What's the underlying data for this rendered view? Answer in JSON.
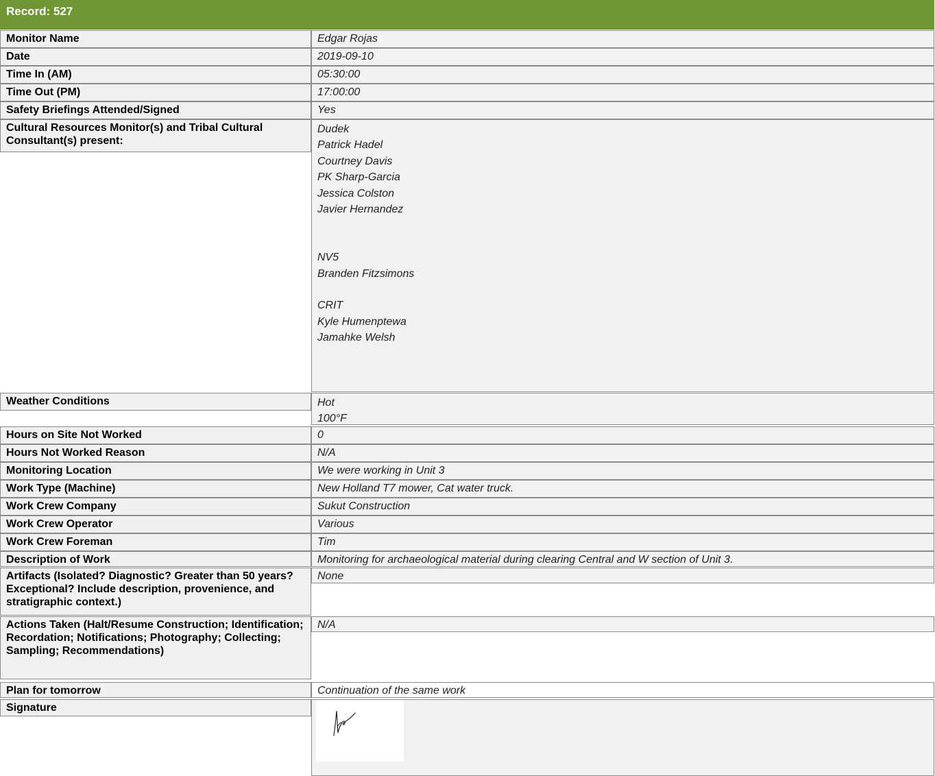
{
  "record": {
    "title": "Record: 527"
  },
  "rows": {
    "monitor_name": {
      "label": "Monitor Name",
      "value": "Edgar Rojas"
    },
    "date": {
      "label": "Date",
      "value": "2019-09-10"
    },
    "time_in": {
      "label": "Time In (AM)",
      "value": "05:30:00"
    },
    "time_out": {
      "label": "Time Out (PM)",
      "value": "17:00:00"
    },
    "safety": {
      "label": "Safety Briefings Attended/Signed",
      "value": "Yes"
    },
    "cultural": {
      "label": "Cultural Resources Monitor(s) and Tribal Cultural Consultant(s) present:",
      "lines": [
        "Dudek",
        "Patrick Hadel",
        "Courtney Davis",
        "PK Sharp-Garcia",
        "Jessica Colston",
        "Javier Hernandez",
        "",
        "",
        "NV5",
        "Branden Fitzsimons",
        "",
        "CRIT",
        "Kyle Humenptewa",
        "Jamahke Welsh"
      ]
    },
    "weather": {
      "label": "Weather Conditions",
      "lines": [
        "Hot",
        "100°F"
      ]
    },
    "hours_not_worked": {
      "label": "Hours on Site Not Worked",
      "value": "0"
    },
    "hours_reason": {
      "label": "Hours Not Worked Reason",
      "value": "N/A"
    },
    "location": {
      "label": "Monitoring Location",
      "value": "We were working in Unit 3"
    },
    "work_type": {
      "label": "Work Type (Machine)",
      "value": "New Holland T7 mower, Cat water truck."
    },
    "crew_company": {
      "label": "Work Crew Company",
      "value": "Sukut Construction"
    },
    "crew_operator": {
      "label": "Work Crew Operator",
      "value": "Various"
    },
    "crew_foreman": {
      "label": "Work Crew Foreman",
      "value": "Tim"
    },
    "description": {
      "label": "Description of Work",
      "value": "Monitoring for archaeological material during clearing Central and W section of Unit 3."
    },
    "artifacts": {
      "label": "Artifacts (Isolated? Diagnostic? Greater than 50 years? Exceptional?  Include description, provenience, and stratigraphic context.)",
      "value": "None"
    },
    "actions": {
      "label": "Actions Taken (Halt/Resume Construction; Identification; Recordation; Notifications; Photography; Collecting; Sampling; Recommendations)",
      "value": "N/A"
    },
    "plan": {
      "label": "Plan for tomorrow",
      "value": "Continuation of the same work"
    },
    "signature": {
      "label": "Signature"
    }
  }
}
